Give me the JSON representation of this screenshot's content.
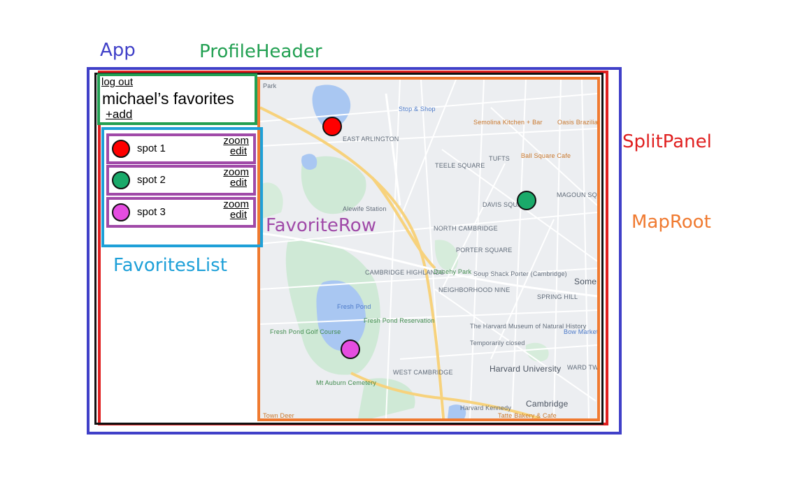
{
  "annotations": {
    "app": "App",
    "profile_header": "ProfileHeader",
    "split_panel": "SplitPanel",
    "map_root": "MapRoot",
    "favorite_row": "FavoriteRow",
    "favorites_list": "FavoritesList"
  },
  "colors": {
    "app": "#4040c8",
    "profile_header": "#22a052",
    "split_panel": "#e02020",
    "map_root": "#f07a30",
    "favorite_row": "#a04aa8",
    "favorites_list": "#1ea0d8",
    "spot1": "#ff0000",
    "spot2": "#1aaa6a",
    "spot3": "#e54de0"
  },
  "profile": {
    "logout": "log out",
    "title": "michael’s favorites",
    "add": "+add"
  },
  "favorites": [
    {
      "name": "spot 1",
      "zoom": "zoom",
      "edit": "edit"
    },
    {
      "name": "spot 2",
      "zoom": "zoom",
      "edit": "edit"
    },
    {
      "name": "spot 3",
      "zoom": "zoom",
      "edit": "edit"
    }
  ],
  "map": {
    "labels": {
      "east_arlington": "EAST ARLINGTON",
      "stop_shop": "Stop & Shop",
      "semolina": "Semolina Kitchen + Bar",
      "oasis": "Oasis Brazilian",
      "tufts": "TUFTS",
      "ball_square": "Ball Square Cafe",
      "teele": "TEELE SQUARE",
      "magoun": "MAGOUN SQUARE",
      "davis": "DAVIS SQUARE",
      "alewife": "Alewife Station",
      "north_cambridge": "NORTH CAMBRIDGE",
      "porter": "PORTER SQUARE",
      "soup_shack": "Soup Shack Porter (Cambridge)",
      "cambridge_highlands": "CAMBRIDGE HIGHLANDS",
      "danehy": "Danehy Park",
      "neighborhood_nine": "NEIGHBORHOOD NINE",
      "spring_hill": "SPRING HILL",
      "somer": "Somer",
      "fresh_pond": "Fresh Pond",
      "fresh_pond_reservation": "Fresh Pond Reservation",
      "fresh_pond_golf": "Fresh Pond Golf Course",
      "harvard_museum": "The Harvard Museum of Natural History",
      "temporarily_closed": "Temporarily closed",
      "bow_market": "Bow Market",
      "ward_two": "WARD TWO",
      "west_cambridge": "WEST CAMBRIDGE",
      "harvard_university": "Harvard University",
      "mt_auburn": "Mt Auburn Cemetery",
      "cambridge": "Cambridge",
      "harvard_kennedy": "Harvard Kennedy",
      "tatte": "Tatte Bakery & Cafe",
      "town_deer": "Town Deer",
      "park": "Park"
    }
  }
}
